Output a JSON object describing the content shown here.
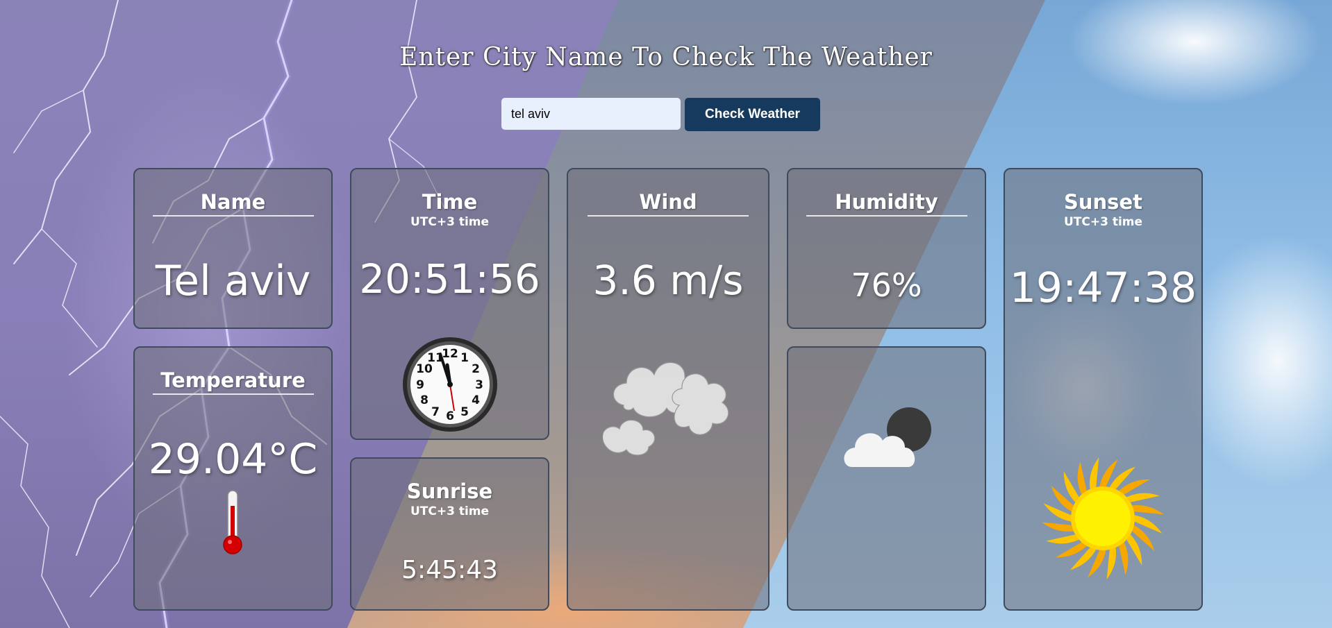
{
  "header": {
    "title": "Enter City Name To Check The Weather"
  },
  "search": {
    "value": "tel aviv",
    "button_label": "Check Weather"
  },
  "cards": {
    "name": {
      "title": "Name",
      "value": "Tel aviv"
    },
    "temperature": {
      "title": "Temperature",
      "value": "29.04°C",
      "icon": "thermometer-icon"
    },
    "time": {
      "title": "Time",
      "subtitle": "UTC+3 time",
      "value": "20:51:56",
      "icon": "clock-icon"
    },
    "sunrise": {
      "title": "Sunrise",
      "subtitle": "UTC+3 time",
      "value": "5:45:43"
    },
    "wind": {
      "title": "Wind",
      "value": "3.6 m/s",
      "icon": "clouds-icon"
    },
    "humidity": {
      "title": "Humidity",
      "value": "76%"
    },
    "condition": {
      "icon": "cloud-moon-icon"
    },
    "sunset": {
      "title": "Sunset",
      "subtitle": "UTC+3 time",
      "value": "19:47:38",
      "icon": "sun-icon"
    }
  },
  "colors": {
    "button_bg": "#163a5e",
    "input_bg": "#e8f0fe",
    "thermometer_red": "#d40000",
    "sun_yellow": "#ffd400"
  }
}
